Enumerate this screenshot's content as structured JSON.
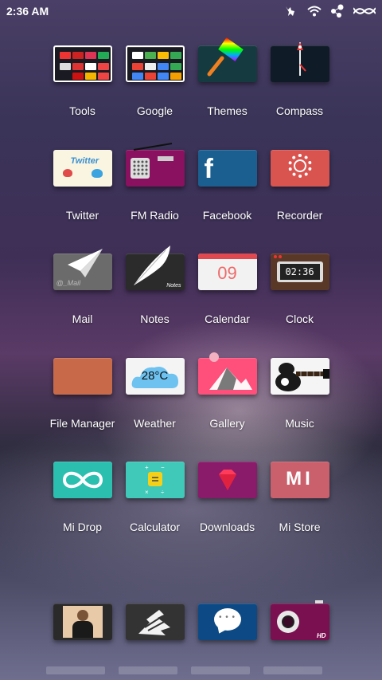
{
  "status_bar": {
    "time": "2:36 AM"
  },
  "apps": [
    {
      "id": "tools",
      "label": "Tools"
    },
    {
      "id": "google",
      "label": "Google"
    },
    {
      "id": "themes",
      "label": "Themes"
    },
    {
      "id": "compass",
      "label": "Compass"
    },
    {
      "id": "twitter",
      "label": "Twitter",
      "tile_text": "Twitter"
    },
    {
      "id": "fm-radio",
      "label": "FM Radio"
    },
    {
      "id": "facebook",
      "label": "Facebook",
      "tile_text": "f"
    },
    {
      "id": "recorder",
      "label": "Recorder"
    },
    {
      "id": "mail",
      "label": "Mail",
      "tile_text": "@_Mail"
    },
    {
      "id": "notes",
      "label": "Notes",
      "tile_text": "Notes"
    },
    {
      "id": "calendar",
      "label": "Calendar",
      "tile_text": "09"
    },
    {
      "id": "clock",
      "label": "Clock",
      "tile_text": "02:36"
    },
    {
      "id": "file-manager",
      "label": "File Manager"
    },
    {
      "id": "weather",
      "label": "Weather",
      "tile_text": "28°C"
    },
    {
      "id": "gallery",
      "label": "Gallery"
    },
    {
      "id": "music",
      "label": "Music"
    },
    {
      "id": "mi-drop",
      "label": "Mi Drop"
    },
    {
      "id": "calculator",
      "label": "Calculator"
    },
    {
      "id": "downloads",
      "label": "Downloads"
    },
    {
      "id": "mi-store",
      "label": "Mi Store",
      "tile_text": "MI"
    }
  ],
  "dock": [
    {
      "id": "contacts"
    },
    {
      "id": "phone"
    },
    {
      "id": "messages",
      "tile_text": "• • •"
    },
    {
      "id": "camera",
      "tile_text": "HD"
    }
  ],
  "colors": {
    "facebook": "#1a5f8f",
    "recorder": "#d9534f",
    "fm_radio": "#8a1060",
    "calendar_top": "#e0494f",
    "file_manager": "#c86a4a",
    "gallery": "#ff4f7b",
    "mi_drop": "#2bbfb0",
    "calculator": "#40c8b8",
    "downloads": "#8a1a6a",
    "mi_store": "#c9606c",
    "music": "#f5f5f5",
    "camera": "#7a1050"
  }
}
